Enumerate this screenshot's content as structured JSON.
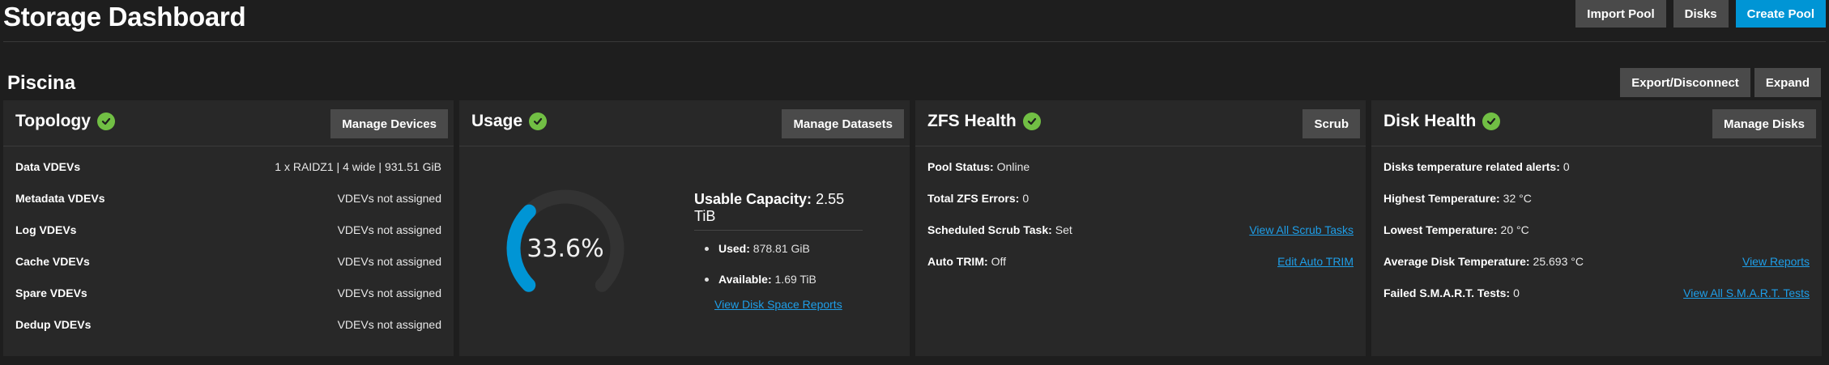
{
  "page": {
    "title": "Storage Dashboard",
    "actions": [
      "Import Pool",
      "Disks",
      "Create Pool"
    ]
  },
  "pool": {
    "name": "Piscina",
    "actions": [
      "Export/Disconnect",
      "Expand"
    ]
  },
  "colors": {
    "background": "#1e1e1e",
    "card": "#282828",
    "button": "#4a4a4a",
    "primary": "#0095d5",
    "healthy": "#71bf44",
    "link": "#1e9ee8",
    "donut_used": "#0095d5",
    "donut_track": "#333333"
  },
  "topology": {
    "title": "Topology",
    "button": "Manage Devices",
    "status_icon": "check-circle-icon",
    "rows": [
      {
        "label": "Data VDEVs",
        "value": "1 x RAIDZ1 | 4 wide | 931.51 GiB"
      },
      {
        "label": "Metadata VDEVs",
        "value": "VDEVs not assigned"
      },
      {
        "label": "Log VDEVs",
        "value": "VDEVs not assigned"
      },
      {
        "label": "Cache VDEVs",
        "value": "VDEVs not assigned"
      },
      {
        "label": "Spare VDEVs",
        "value": "VDEVs not assigned"
      },
      {
        "label": "Dedup VDEVs",
        "value": "VDEVs not assigned"
      }
    ]
  },
  "usage": {
    "title": "Usage",
    "button": "Manage Datasets",
    "status_icon": "check-circle-icon",
    "percent_label": "33.6%",
    "percent_value": 33.6,
    "usable_label": "Usable Capacity:",
    "usable_value": "2.55 TiB",
    "used_label": "Used:",
    "used_value": "878.81 GiB",
    "available_label": "Available:",
    "available_value": "1.69 TiB",
    "link": "View Disk Space Reports"
  },
  "zfs": {
    "title": "ZFS Health",
    "button": "Scrub",
    "status_icon": "check-circle-icon",
    "rows": [
      {
        "label": "Pool Status:",
        "value": "Online",
        "link": ""
      },
      {
        "label": "Total ZFS Errors:",
        "value": "0",
        "link": ""
      },
      {
        "label": "Scheduled Scrub Task:",
        "value": "Set",
        "link": "View All Scrub Tasks"
      },
      {
        "label": "Auto TRIM:",
        "value": "Off",
        "link": "Edit Auto TRIM"
      }
    ]
  },
  "disk": {
    "title": "Disk Health",
    "button": "Manage Disks",
    "status_icon": "check-circle-icon",
    "rows": [
      {
        "label": "Disks temperature related alerts:",
        "value": "0",
        "link": ""
      },
      {
        "label": "Highest Temperature:",
        "value": "32 °C",
        "link": ""
      },
      {
        "label": "Lowest Temperature:",
        "value": "20 °C",
        "link": ""
      },
      {
        "label": "Average Disk Temperature:",
        "value": "25.693 °C",
        "link": "View Reports"
      },
      {
        "label": "Failed S.M.A.R.T. Tests:",
        "value": "0",
        "link": "View All S.M.A.R.T. Tests"
      }
    ]
  }
}
